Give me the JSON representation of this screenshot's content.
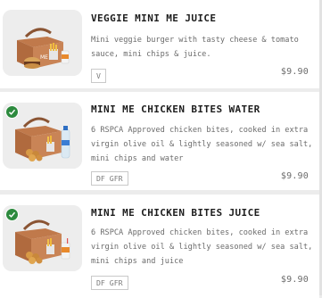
{
  "menu_items": [
    {
      "title": "VEGGIE MINI ME JUICE",
      "description": "Mini veggie burger with tasty cheese & tomato sauce, mini chips & juice.",
      "tags": "V",
      "price": "$9.90",
      "image": "veggie-burger-box-image",
      "badge": null
    },
    {
      "title": "MINI ME CHICKEN BITES WATER",
      "description": "6 RSPCA Approved chicken bites, cooked in extra virgin olive oil & lightly seasoned w/ sea salt, mini chips and water",
      "tags": "DF GFR",
      "price": "$9.90",
      "image": "chicken-bites-water-box-image",
      "badge": "checkmark-icon"
    },
    {
      "title": "MINI ME CHICKEN BITES JUICE",
      "description": "6 RSPCA Approved chicken bites, cooked in extra virgin olive oil & lightly seasoned w/ sea salt, mini chips and juice",
      "tags": "DF GFR",
      "price": "$9.90",
      "image": "chicken-bites-juice-box-image",
      "badge": "checkmark-icon"
    }
  ],
  "colors": {
    "background": "#ececec",
    "card": "#ffffff",
    "title": "#1d1d1d",
    "text": "#6b6b6b",
    "badge": "#2d8a3e"
  }
}
